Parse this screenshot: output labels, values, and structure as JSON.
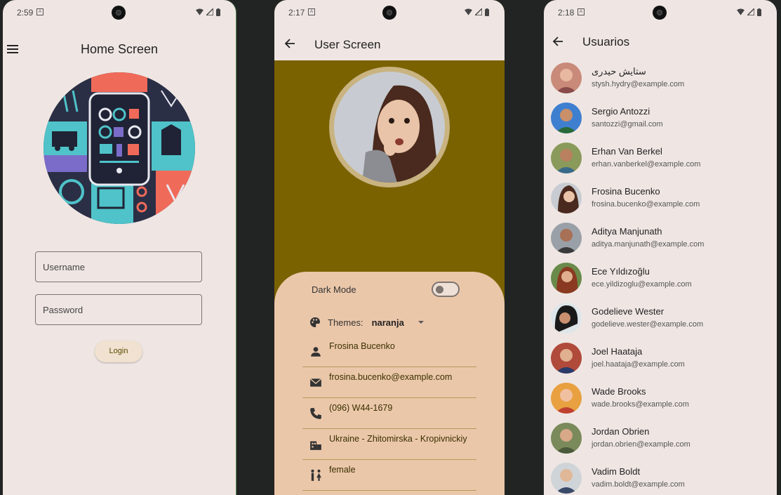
{
  "phone1": {
    "time": "2:59",
    "title": "Home Screen",
    "username_placeholder": "Username",
    "password_placeholder": "Password",
    "login_label": "Login"
  },
  "phone2": {
    "time": "2:17",
    "title": "User Screen",
    "dark_mode_label": "Dark Mode",
    "dark_mode_on": false,
    "themes_label": "Themes:",
    "theme_value": "naranja",
    "name": "Frosina Bucenko",
    "email": "frosina.bucenko@example.com",
    "phone": "(096) W44-1679",
    "location": "Ukraine - Zhitomirska - Kropivnickiy",
    "gender": "female"
  },
  "phone3": {
    "time": "2:18",
    "title": "Usuarios",
    "users": [
      {
        "name": "ستايش حيدرى",
        "email": "stysh.hydry@example.com"
      },
      {
        "name": "Sergio Antozzi",
        "email": "santozzi@gmail.com"
      },
      {
        "name": "Erhan Van Berkel",
        "email": "erhan.vanberkel@example.com"
      },
      {
        "name": "Frosina Bucenko",
        "email": "frosina.bucenko@example.com"
      },
      {
        "name": "Aditya Manjunath",
        "email": "aditya.manjunath@example.com"
      },
      {
        "name": "Ece Yıldızoğlu",
        "email": "ece.yildizoglu@example.com"
      },
      {
        "name": "Godelieve Wester",
        "email": "godelieve.wester@example.com"
      },
      {
        "name": "Joel Haataja",
        "email": "joel.haataja@example.com"
      },
      {
        "name": "Wade Brooks",
        "email": "wade.brooks@example.com"
      },
      {
        "name": "Jordan Obrien",
        "email": "jordan.obrien@example.com"
      },
      {
        "name": "Vadim Boldt",
        "email": "vadim.boldt@example.com"
      }
    ]
  },
  "colors": {
    "background": "#222423",
    "surface": "#efe6e3",
    "primary_dark": "#7a6200",
    "sheet": "#ebc7aa"
  }
}
